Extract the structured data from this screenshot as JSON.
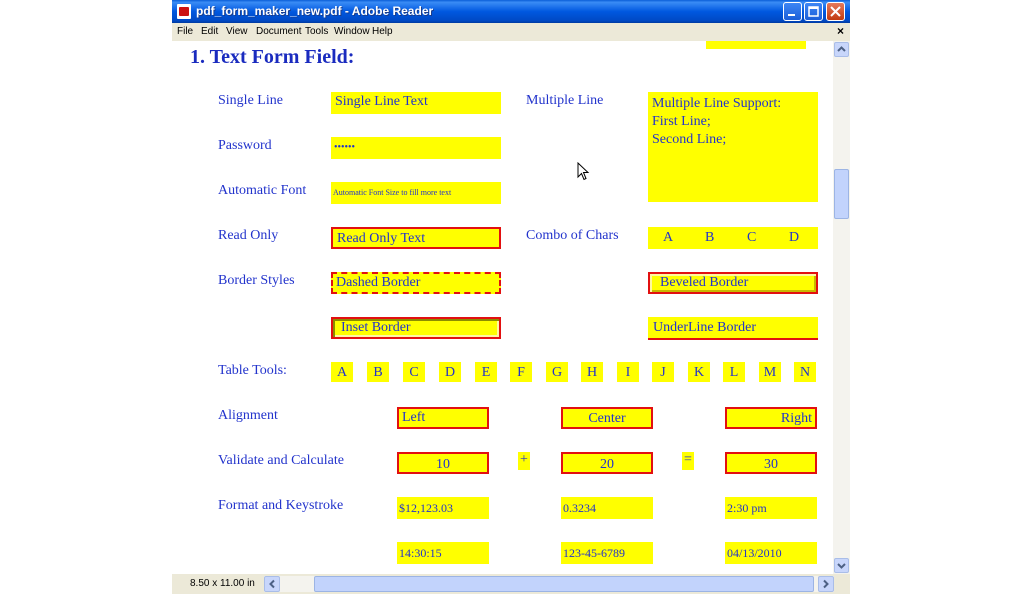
{
  "window": {
    "title": "pdf_form_maker_new.pdf - Adobe Reader"
  },
  "menu": [
    "File",
    "Edit",
    "View",
    "Document",
    "Tools",
    "Window",
    "Help"
  ],
  "menu_close": "×",
  "heading": "1. Text Form Field:",
  "labels": {
    "single_line": "Single Line",
    "password": "Password",
    "automatic_font": "Automatic Font",
    "read_only": "Read Only",
    "border_styles": "Border Styles",
    "table_tools": "Table Tools:",
    "alignment": "Alignment",
    "validate": "Validate and Calculate",
    "format": "Format and Keystroke",
    "multiple_line": "Multiple Line",
    "combo": "Combo of Chars"
  },
  "fields": {
    "single_line": "Single Line Text",
    "password": "••••••",
    "automatic_font": "Automatic Font Size to fill more text",
    "read_only": "Read Only Text",
    "multiline_1": "Multiple Line Support:",
    "multiline_2": "First Line;",
    "multiline_3": "Second Line;",
    "dashed": "Dashed Border",
    "beveled": "Beveled Border",
    "inset": "Inset Border",
    "underline": "UnderLine Border",
    "align_left": "Left",
    "align_center": "Center",
    "align_right": "Right",
    "val_a": "10",
    "op_plus": "+",
    "val_b": "20",
    "op_eq": "=",
    "val_c": "30",
    "fmt_currency": "$12,123.03",
    "fmt_number": "0.3234",
    "fmt_time": "2:30 pm",
    "fmt_time24": "14:30:15",
    "fmt_ssn": "123-45-6789",
    "fmt_date": "04/13/2010"
  },
  "combo_chars": [
    "A",
    "B",
    "C",
    "D"
  ],
  "table_cells": [
    "A",
    "B",
    "C",
    "D",
    "E",
    "F",
    "G",
    "H",
    "I",
    "J",
    "K",
    "L",
    "M",
    "N"
  ],
  "status": {
    "page_size": "8.50 x 11.00 in"
  }
}
